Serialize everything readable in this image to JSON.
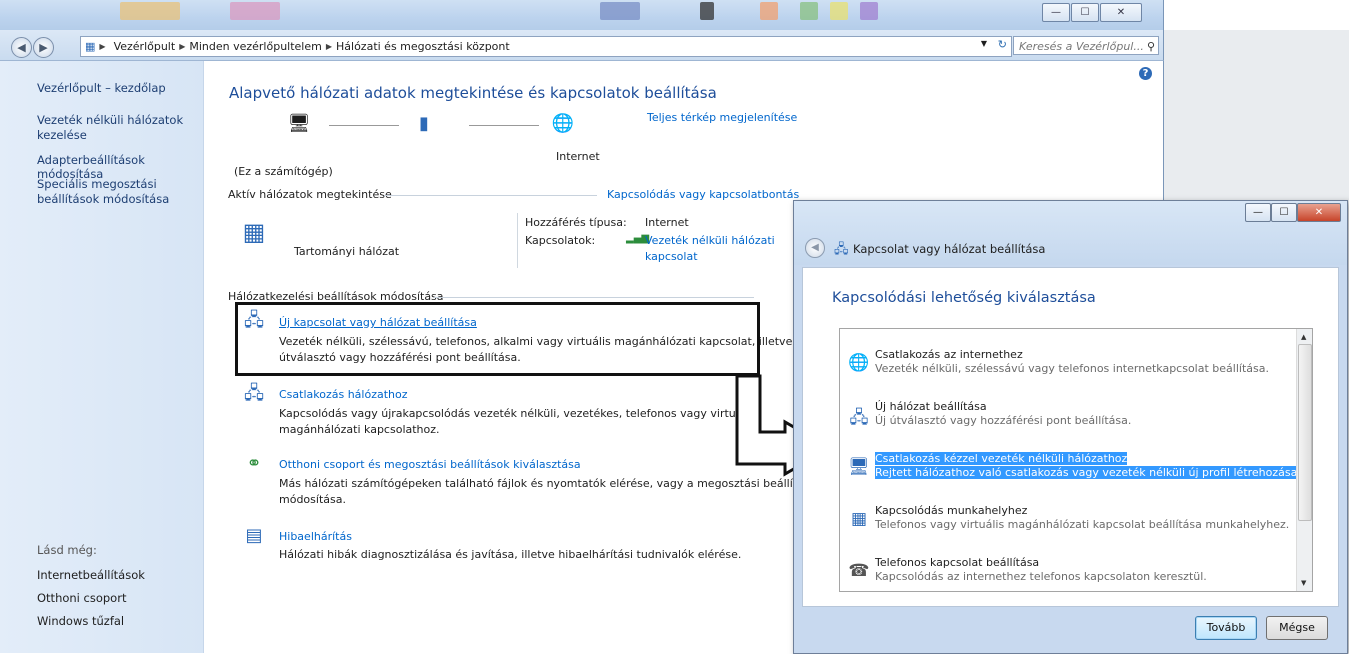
{
  "address": {
    "crumbs": [
      "Vezérlőpult",
      "Minden vezérlőpultelem",
      "Hálózati és megosztási központ"
    ],
    "search_placeholder": "Keresés a Vezérlőpul..."
  },
  "window_buttons": {
    "minimize": "—",
    "maximize": "☐",
    "close": "✕"
  },
  "left_panel": {
    "home": "Vezérlőpult – kezdőlap",
    "links": [
      "Vezeték nélküli hálózatok",
      "kezelése",
      "Adapterbeállítások módosítása",
      "Speciális megosztási",
      "beállítások módosítása"
    ],
    "see_also_label": "Lásd még:",
    "see_also": [
      "Internetbeállítások",
      "Otthoni csoport",
      "Windows tűzfal"
    ]
  },
  "main": {
    "title": "Alapvető hálózati adatok megtekintése és kapcsolatok beállítása",
    "full_map": "Teljes térkép megjelenítése",
    "internet_label": "Internet",
    "this_computer": "(Ez a számítógép)",
    "active_networks_label": "Aktív hálózatok megtekintése",
    "connect_disconnect": "Kapcsolódás vagy kapcsolatbontás",
    "network_name": "Tartományi hálózat",
    "access_type_label": "Hozzáférés típusa:",
    "access_type_value": "Internet",
    "connections_label": "Kapcsolatok:",
    "connection_value_1": "Vezeték nélküli hálózati",
    "connection_value_2": "kapcsolat",
    "change_settings_label": "Hálózatkezelési beállítások módosítása",
    "tasks": [
      {
        "title": "Új kapcsolat vagy hálózat beállítása",
        "desc1": "Vezeték nélküli, szélessávú, telefonos, alkalmi vagy virtuális magánhálózati kapcsolat, illetve",
        "desc2": "útválasztó vagy hozzáférési pont beállítása."
      },
      {
        "title": "Csatlakozás hálózathoz",
        "desc1": "Kapcsolódás vagy újrakapcsolódás vezeték nélküli, vezetékes, telefonos vagy virtuális",
        "desc2": "magánhálózati kapcsolathoz."
      },
      {
        "title": "Otthoni csoport és megosztási beállítások kiválasztása",
        "desc1": "Más hálózati számítógépeken található fájlok és nyomtatók elérése, vagy a megosztási beállítások",
        "desc2": "módosítása."
      },
      {
        "title": "Hibaelhárítás",
        "desc1": "Hálózati hibák diagnosztizálása és javítása, illetve hibaelhárítási tudnivalók elérése.",
        "desc2": ""
      }
    ]
  },
  "dialog": {
    "window_title": "Kapcsolat vagy hálózat beállítása",
    "heading": "Kapcsolódási lehetőség kiválasztása",
    "options": [
      {
        "title": "Csatlakozás az internethez",
        "desc": "Vezeték nélküli, szélessávú vagy telefonos internetkapcsolat beállítása."
      },
      {
        "title": "Új hálózat beállítása",
        "desc": "Új útválasztó vagy hozzáférési pont beállítása."
      },
      {
        "title": "Csatlakozás kézzel vezeték nélküli hálózathoz",
        "desc": "Rejtett hálózathoz való csatlakozás vagy vezeték nélküli új profil létrehozása."
      },
      {
        "title": "Kapcsolódás munkahelyhez",
        "desc": "Telefonos vagy virtuális magánhálózati kapcsolat beállítása munkahelyhez."
      },
      {
        "title": "Telefonos kapcsolat beállítása",
        "desc": "Kapcsolódás az internethez telefonos kapcsolaton keresztül."
      }
    ],
    "next_button": "Tovább",
    "cancel_button": "Mégse"
  }
}
